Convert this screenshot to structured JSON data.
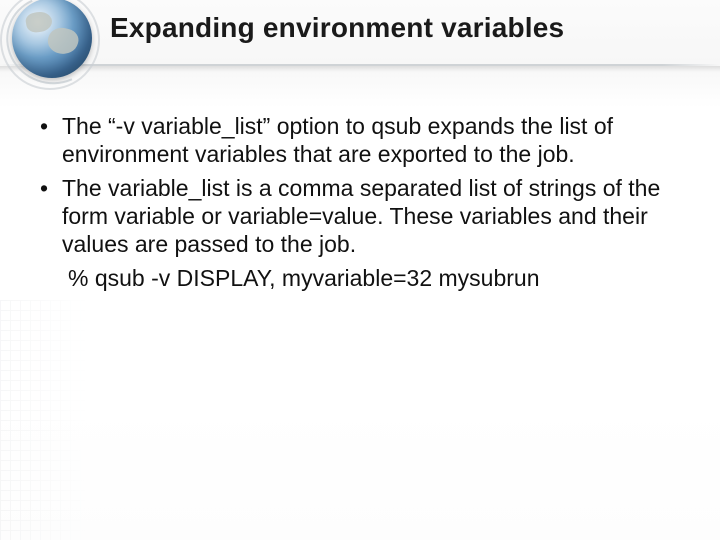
{
  "title": "Expanding environment variables",
  "bullets": [
    "The “-v variable_list” option to qsub expands the list of environment variables that are exported to the job.",
    "The variable_list is a comma separated list of strings of the form variable or variable=value. These variables and their values are passed to the job."
  ],
  "example": "% qsub -v DISPLAY, myvariable=32 mysubrun"
}
